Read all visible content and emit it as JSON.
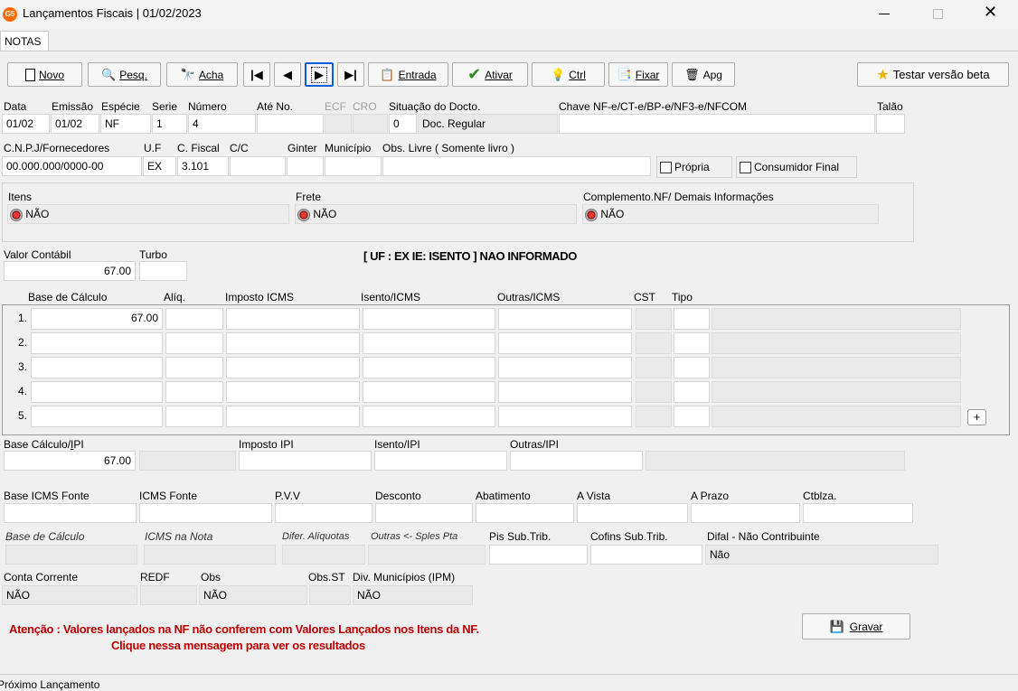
{
  "window": {
    "title": "Lançamentos Fiscais |  01/02/2023",
    "app_badge": "G5"
  },
  "tabs": {
    "notas": "NOTAS"
  },
  "toolbar": {
    "novo": "Novo",
    "pesq": "Pesq.",
    "acha": "Acha",
    "entrada": "Entrada",
    "ativar": "Ativar",
    "ctrl": "Ctrl",
    "fixar": "Fixar",
    "apg": "Apg",
    "testar": "Testar versão beta"
  },
  "header": {
    "labels": {
      "data": "Data",
      "emissao": "Emissão",
      "especie": "Espécie",
      "serie": "Serie",
      "numero": "Número",
      "ate": "Até No.",
      "ecf": "ECF",
      "cro": "CRO",
      "situacao": "Situação do Docto.",
      "chave": "Chave NF-e/CT-e/BP-e/NF3-e/NFCOM",
      "talao": "Talão"
    },
    "values": {
      "data": "01/02",
      "emissao": "01/02",
      "especie": "NF",
      "serie": "1",
      "numero": "4",
      "situacao_code": "0",
      "situacao_desc": "Doc. Regular"
    }
  },
  "row2": {
    "labels": {
      "cnpj": "C.N.P.J/Fornecedores",
      "uf": "U.F",
      "cfiscal": "C. Fiscal",
      "cc": "C/C",
      "ginter": "Ginter",
      "municipio": "Município",
      "obs_livre": "Obs. Livre ( Somente livro )",
      "propria": "Própria",
      "consumidor": "Consumidor Final"
    },
    "values": {
      "cnpj": "00.000.000/0000-00",
      "uf": "EX",
      "cfiscal": "3.101"
    }
  },
  "group": {
    "itens_label": "Itens",
    "itens_value": "NÃO",
    "frete_label": "Frete",
    "frete_value": "NÃO",
    "complemento_label": "Complemento.NF/ Demais Informações",
    "complemento_value": "NÃO"
  },
  "valor": {
    "contabil_label": "Valor Contábil",
    "contabil": "67.00",
    "turbo_label": "Turbo",
    "uf_msg": "[ UF : EX IE: ISENTO ] NAO INFORMADO"
  },
  "icms": {
    "headers": {
      "base": "Base de Cálculo",
      "aliq": "Alíq.",
      "imposto": "Imposto ICMS",
      "isento": "Isento/ICMS",
      "outras": "Outras/ICMS",
      "cst": "CST",
      "tipo": "Tipo"
    },
    "rows": [
      {
        "n": "1.",
        "base": "67.00"
      },
      {
        "n": "2.",
        "base": ""
      },
      {
        "n": "3.",
        "base": ""
      },
      {
        "n": "4.",
        "base": ""
      },
      {
        "n": "5.",
        "base": ""
      }
    ],
    "add": "+"
  },
  "ipi": {
    "base_label": "Base Cálculo/IPI",
    "base": "67.00",
    "imposto_label": "Imposto IPI",
    "isento_label": "Isento/IPI",
    "outras_label": "Outras/IPI"
  },
  "fonte": {
    "base_label": "Base ICMS Fonte",
    "icms_label": "ICMS Fonte",
    "pvv_label": "P.V.V",
    "desconto_label": "Desconto",
    "abatimento_label": "Abatimento",
    "avista_label": "A Vista",
    "aprazo_label": "A Prazo",
    "ctblza_label": "Ctblza."
  },
  "dif": {
    "base_label": "Base de Cálculo",
    "icms_nota_label": "ICMS na Nota",
    "difer_label": "Difer. Alíquotas",
    "outras_label": "Outras <- Sples Pta",
    "pis_label": "Pis Sub.Trib.",
    "cofins_label": "Cofins Sub.Trib.",
    "difal_label": "Difal - Não Contribuinte",
    "difal_value": "Não"
  },
  "conta": {
    "cc_label": "Conta Corrente",
    "cc_value": "NÃO",
    "redf_label": "REDF",
    "obs_label": "Obs",
    "obs_value": "NÃO",
    "obsst_label": "Obs.ST",
    "div_label": "Div. Municípios (IPM)",
    "div_value": "NÃO"
  },
  "warning": {
    "line1": "Atenção : Valores lançados na NF não conferem com Valores Lançados nos Itens da NF.",
    "line2": "Clique nessa mensagem para ver os resultados"
  },
  "gravar": "Gravar",
  "status": "Próximo  Lançamento"
}
